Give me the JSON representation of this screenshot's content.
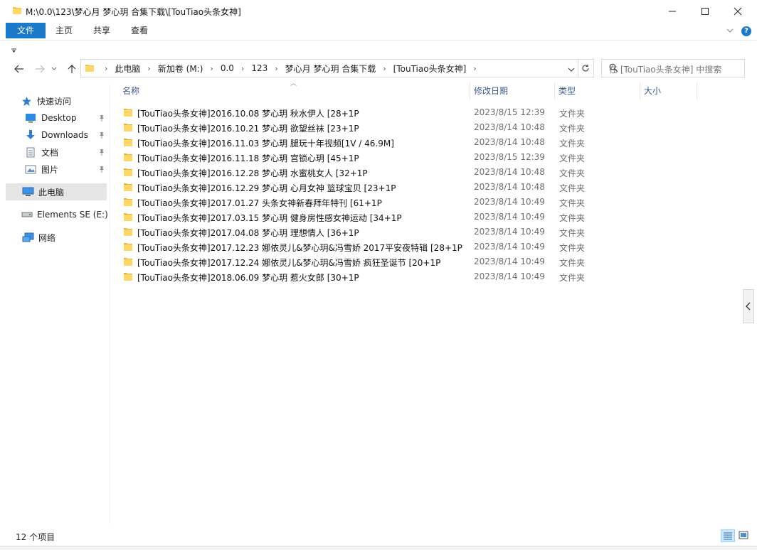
{
  "window": {
    "title": "M:\\0.0\\123\\梦心月 梦心玥 合集下载\\[TouTiao头条女神]"
  },
  "ribbon": {
    "tabs": [
      {
        "label": "文件"
      },
      {
        "label": "主页"
      },
      {
        "label": "共享"
      },
      {
        "label": "查看"
      }
    ]
  },
  "address": {
    "crumbs": [
      "此电脑",
      "新加卷 (M:)",
      "0.0",
      "123",
      "梦心月 梦心玥 合集下载",
      "[TouTiao头条女神]"
    ]
  },
  "search": {
    "placeholder": "在 [TouTiao头条女神] 中搜索"
  },
  "nav": {
    "quick_access": "快速访问",
    "desktop": "Desktop",
    "downloads": "Downloads",
    "documents": "文档",
    "pictures": "图片",
    "this_pc": "此电脑",
    "drive": "Elements SE (E:)",
    "network": "网络"
  },
  "columns": {
    "name": "名称",
    "date": "修改日期",
    "type": "类型",
    "size": "大小"
  },
  "files": [
    {
      "name": "[TouTiao头条女神]2016.10.08 梦心玥 秋水伊人 [28+1P",
      "date": "2023/8/15 12:39",
      "type": "文件夹"
    },
    {
      "name": "[TouTiao头条女神]2016.10.21 梦心玥 欲望丝袜 [23+1P",
      "date": "2023/8/14 10:48",
      "type": "文件夹"
    },
    {
      "name": "[TouTiao头条女神]2016.11.03 梦心玥 腿玩十年视频[1V / 46.9M]",
      "date": "2023/8/14 10:48",
      "type": "文件夹"
    },
    {
      "name": "[TouTiao头条女神]2016.11.18 梦心玥 宫锁心玥 [45+1P",
      "date": "2023/8/15 12:39",
      "type": "文件夹"
    },
    {
      "name": "[TouTiao头条女神]2016.12.28 梦心玥 水蜜桃女人 [32+1P",
      "date": "2023/8/14 10:48",
      "type": "文件夹"
    },
    {
      "name": "[TouTiao头条女神]2016.12.29 梦心玥 心月女神 篮球宝贝 [23+1P",
      "date": "2023/8/14 10:48",
      "type": "文件夹"
    },
    {
      "name": "[TouTiao头条女神]2017.01.27 头条女神新春拜年特刊 [61+1P",
      "date": "2023/8/14 10:49",
      "type": "文件夹"
    },
    {
      "name": "[TouTiao头条女神]2017.03.15 梦心玥 健身房性感女神运动 [34+1P",
      "date": "2023/8/14 10:49",
      "type": "文件夹"
    },
    {
      "name": "[TouTiao头条女神]2017.04.08 梦心玥 理想情人 [36+1P",
      "date": "2023/8/14 10:49",
      "type": "文件夹"
    },
    {
      "name": "[TouTiao头条女神]2017.12.23 娜依灵儿&梦心玥&冯雪娇 2017平安夜特辑 [28+1P",
      "date": "2023/8/14 10:49",
      "type": "文件夹"
    },
    {
      "name": "[TouTiao头条女神]2017.12.24 娜依灵儿&梦心玥&冯雪娇 疯狂圣诞节 [20+1P",
      "date": "2023/8/14 10:49",
      "type": "文件夹"
    },
    {
      "name": "[TouTiao头条女神]2018.06.09 梦心玥 惹火女郎 [30+1P",
      "date": "2023/8/14 10:49",
      "type": "文件夹"
    }
  ],
  "status": {
    "count": "12 个项目"
  },
  "colors": {
    "accent": "#1979ca",
    "folder": "#f5c04a",
    "selected_nav": "#e5e5e5"
  }
}
